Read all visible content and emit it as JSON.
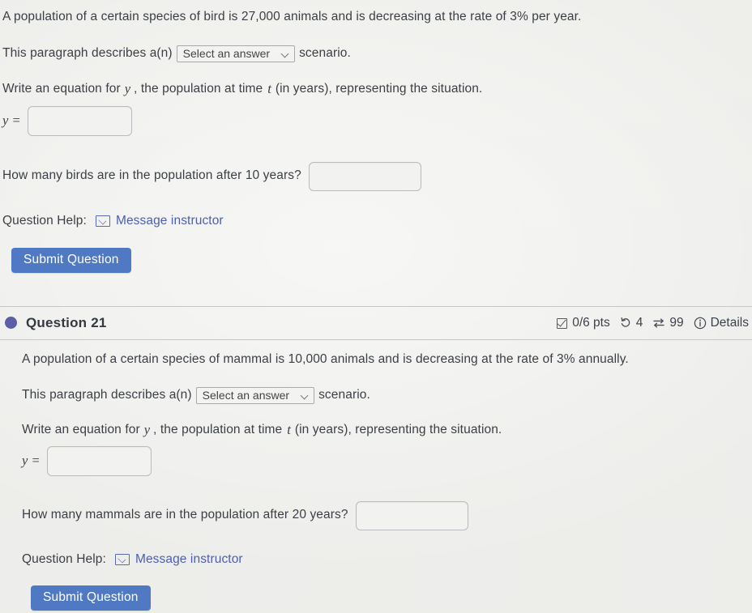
{
  "question_20": {
    "prompt": "A population of a certain species of bird is 27,000 animals and is decreasing at the rate of 3% per year.",
    "describes_prefix": "This paragraph describes a(n)",
    "describes_suffix": "scenario.",
    "select": {
      "value": "Select an answer",
      "chevron_icon": "chevron-down-icon"
    },
    "equation_instruction_parts": {
      "a": "Write an equation for",
      "var_y": "y",
      "b": ", the population at time",
      "var_t": "t",
      "c": "(in years), representing the situation."
    },
    "equation_label": "y =",
    "equation_input_value": "",
    "equation_input_placeholder": "",
    "followup_question": "How many birds are in the population after 10 years?",
    "followup_input_value": "",
    "followup_input_placeholder": "",
    "help_label": "Question Help:",
    "help_link": "Message instructor",
    "help_icon": "mail-icon",
    "submit_label": "Submit Question"
  },
  "question_21": {
    "header": {
      "status_icon": "filled-circle-icon",
      "title": "Question 21",
      "points": "0/6 pts",
      "points_icon": "check-square-icon",
      "attempts": "4",
      "attempts_icon": "rotate-counterclockwise-icon",
      "exchanges": "99",
      "exchanges_icon": "swap-arrows-icon",
      "details_icon": "info-circle-icon",
      "details_label": "Details"
    },
    "prompt": "A population of a certain species of mammal is 10,000 animals and is decreasing at the rate of 3% annually.",
    "describes_prefix": "This paragraph describes a(n)",
    "describes_suffix": "scenario.",
    "select": {
      "value": "Select an answer",
      "chevron_icon": "chevron-down-icon"
    },
    "equation_instruction_parts": {
      "a": "Write an equation for",
      "var_y": "y",
      "b": ", the population at time",
      "var_t": "t",
      "c": "(in years), representing the situation."
    },
    "equation_label": "y =",
    "equation_input_value": "",
    "equation_input_placeholder": "",
    "followup_question": "How many mammals are in the population after 20 years?",
    "followup_input_value": "",
    "followup_input_placeholder": "",
    "help_label": "Question Help:",
    "help_link": "Message instructor",
    "help_icon": "mail-icon",
    "submit_label": "Submit Question"
  },
  "colors": {
    "page_background": "#eeeeec",
    "submit_button": "#5079c4",
    "link": "#4c5fb0",
    "status_dot": "#5a5fa6",
    "text": "#3b3f45",
    "divider": "#c6c8c8",
    "input_border": "#b8bcc0"
  }
}
